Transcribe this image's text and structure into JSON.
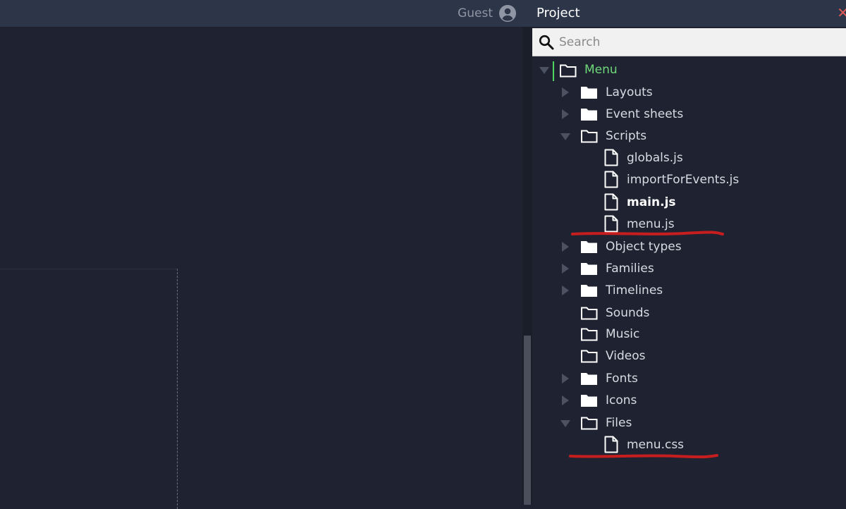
{
  "header": {
    "guest_label": "Guest"
  },
  "panel": {
    "title": "Project",
    "close_glyph": "✕",
    "search_placeholder": "Search"
  },
  "tree": {
    "root": "Menu",
    "items": {
      "layouts": "Layouts",
      "event_sheets": "Event sheets",
      "scripts": "Scripts",
      "globals": "globals.js",
      "importforevents": "importForEvents.js",
      "main": "main.js",
      "menu_js": "menu.js",
      "object_types": "Object types",
      "families": "Families",
      "timelines": "Timelines",
      "sounds": "Sounds",
      "music": "Music",
      "videos": "Videos",
      "fonts": "Fonts",
      "icons": "Icons",
      "files": "Files",
      "menu_css": "menu.css"
    }
  },
  "colors": {
    "background": "#1f2331",
    "header": "#2d3548",
    "root_label": "#6fd87a",
    "annotation": "#d81e1e",
    "close": "#e05a5a"
  }
}
